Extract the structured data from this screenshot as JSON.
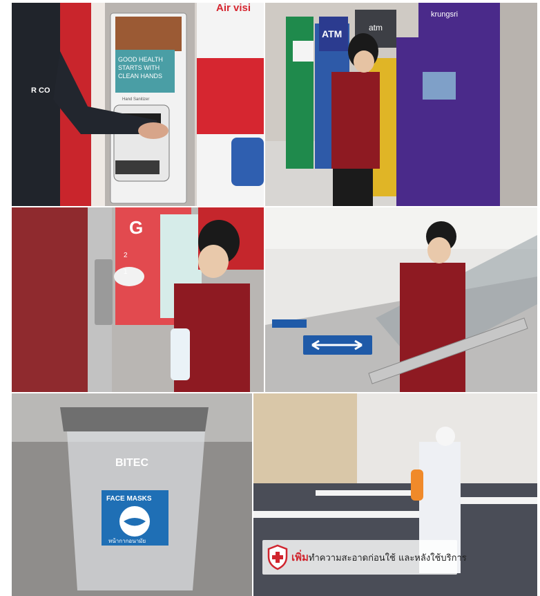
{
  "tiles": {
    "hand_sanitizer": {
      "sign_top": "Air visi",
      "sanitizer_sign": [
        "GOOD HEALTH",
        "STARTS WITH",
        "CLEAN HANDS"
      ],
      "sanitizer_small": "Hand Sanitizer",
      "wall_text": "R CO"
    },
    "atm_cleaning": {
      "atm_sign": "ATM",
      "krungsri_sign": "atm",
      "purple_sign": "krungsri"
    },
    "elevator_cleaning": {
      "floor_letter": "G",
      "floor_numbers": [
        "2",
        "1"
      ]
    },
    "escalator_cleaning": {},
    "mask_bin": {
      "brand": "BITEC",
      "label": "FACE MASKS",
      "label_thai": "หน้ากากอนามัย"
    },
    "room_disinfection": {
      "banner_highlight": "เพิ่ม",
      "banner_text": "ทำความสะอาดก่อนใช้ และหลังใช้บริการ"
    }
  },
  "colors": {
    "brand_red": "#d0252e",
    "uniform_red": "#8e1a22",
    "atm_purple": "#4a2a8a",
    "mask_blue": "#1f6fb5"
  }
}
